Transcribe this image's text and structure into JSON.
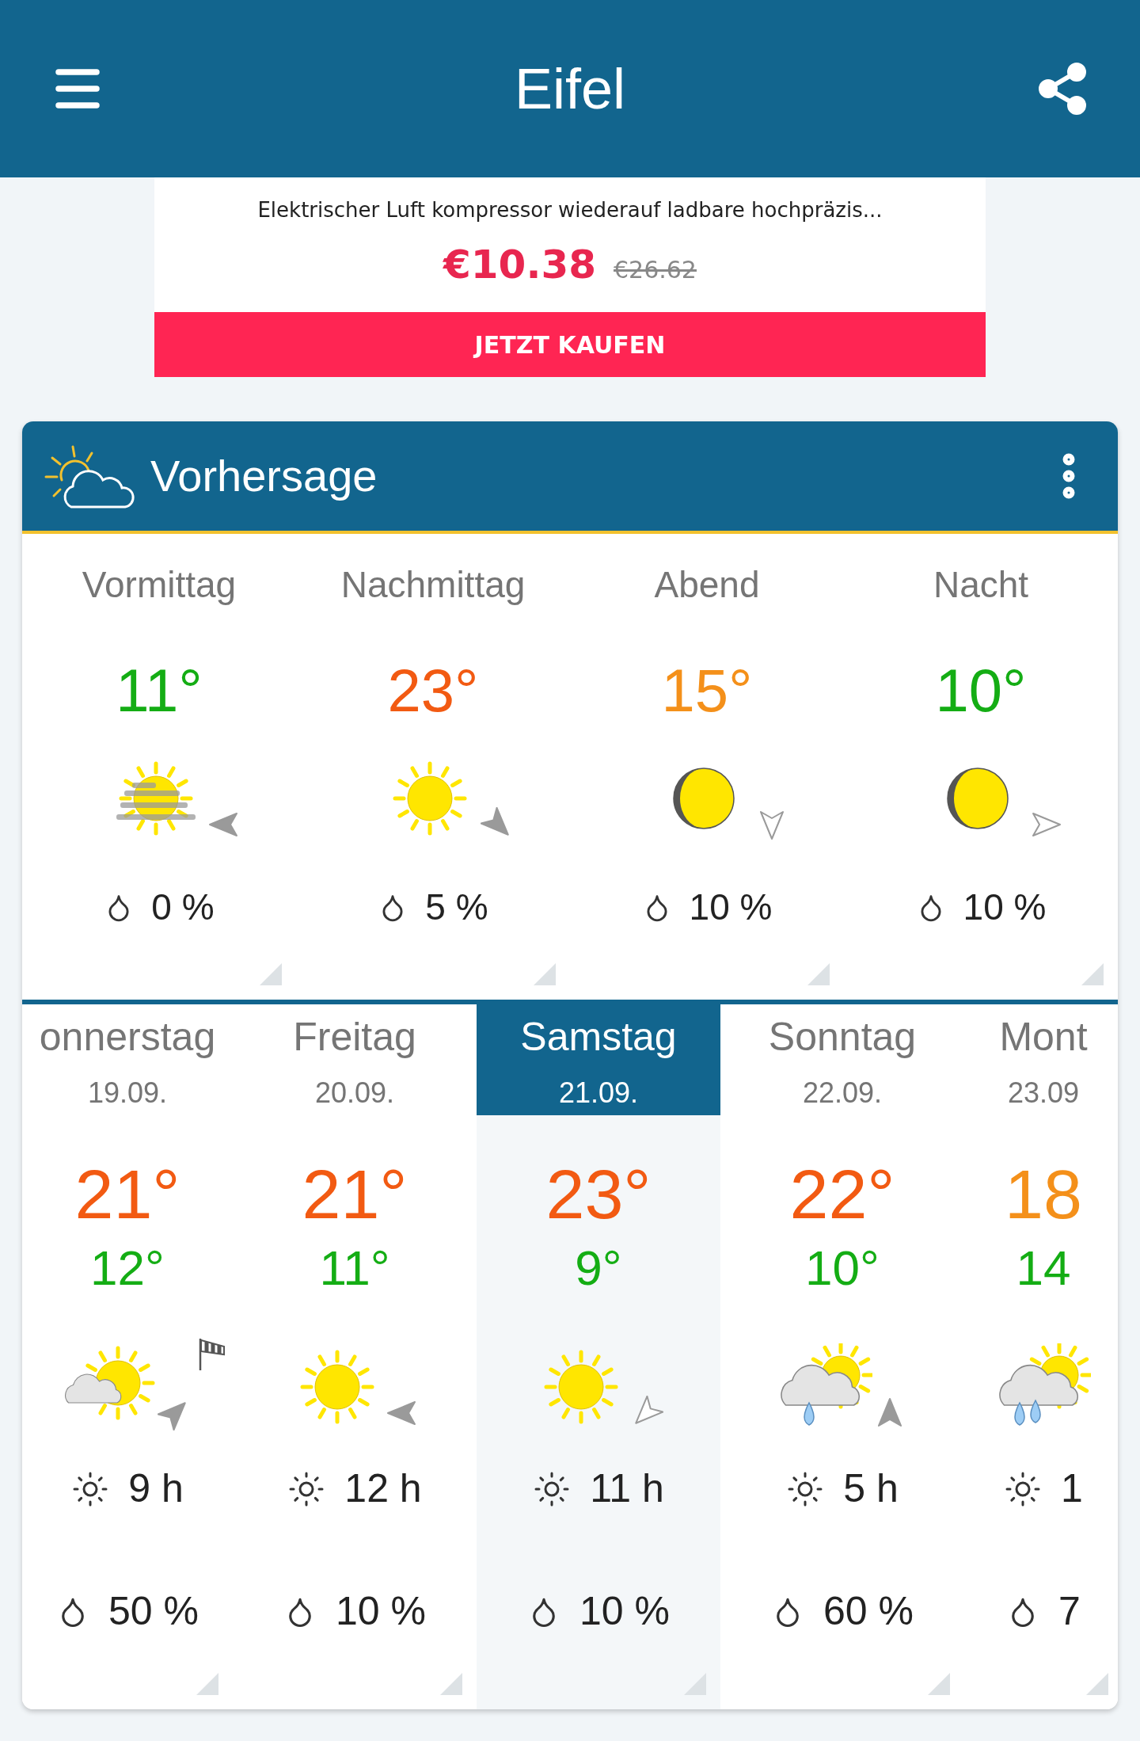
{
  "app_bar": {
    "title": "Eifel"
  },
  "ad": {
    "title": "Elektrischer Luft kompressor wiederauf ladbare hochpräzis...",
    "price": "€10.38",
    "old_price": "€26.62",
    "button": "JETZT KAUFEN"
  },
  "forecast": {
    "title": "Vorhersage",
    "parts": [
      {
        "label": "Vormittag",
        "temp": "11°",
        "color": "#14ad14",
        "kind": "fog",
        "rain": "0 %"
      },
      {
        "label": "Nachmittag",
        "temp": "23°",
        "color": "#f25a12",
        "kind": "sunny",
        "rain": "5 %"
      },
      {
        "label": "Abend",
        "temp": "15°",
        "color": "#f4901a",
        "kind": "moon",
        "rain": "10 %"
      },
      {
        "label": "Nacht",
        "temp": "10°",
        "color": "#14ad14",
        "kind": "moon",
        "rain": "10 %"
      }
    ],
    "days": [
      {
        "name": "onnerstag",
        "date": "19.09.",
        "high": {
          "text": "21°",
          "color": "#f25a12"
        },
        "low": {
          "text": "12°",
          "color": "#14ad14"
        },
        "kind": "cloudy",
        "gust": true,
        "sunshine": "9 h",
        "rain": "50 %",
        "selected": false
      },
      {
        "name": "Freitag",
        "date": "20.09.",
        "high": {
          "text": "21°",
          "color": "#f25a12"
        },
        "low": {
          "text": "11°",
          "color": "#14ad14"
        },
        "kind": "sunny",
        "gust": false,
        "sunshine": "12 h",
        "rain": "10 %",
        "selected": false
      },
      {
        "name": "Samstag",
        "date": "21.09.",
        "high": {
          "text": "23°",
          "color": "#f25a12"
        },
        "low": {
          "text": "9°",
          "color": "#14ad14"
        },
        "kind": "sunny",
        "gust": false,
        "sunshine": "11 h",
        "rain": "10 %",
        "selected": true
      },
      {
        "name": "Sonntag",
        "date": "22.09.",
        "high": {
          "text": "22°",
          "color": "#f25a12"
        },
        "low": {
          "text": "10°",
          "color": "#14ad14"
        },
        "kind": "showers",
        "gust": false,
        "sunshine": "5 h",
        "rain": "60 %",
        "selected": false
      },
      {
        "name": "Mont",
        "date": "23.09",
        "high": {
          "text": "18",
          "color": "#f4901a"
        },
        "low": {
          "text": "14",
          "color": "#14ad14"
        },
        "kind": "rain",
        "sunshine": "1",
        "rain": "7",
        "selected": false
      }
    ]
  }
}
